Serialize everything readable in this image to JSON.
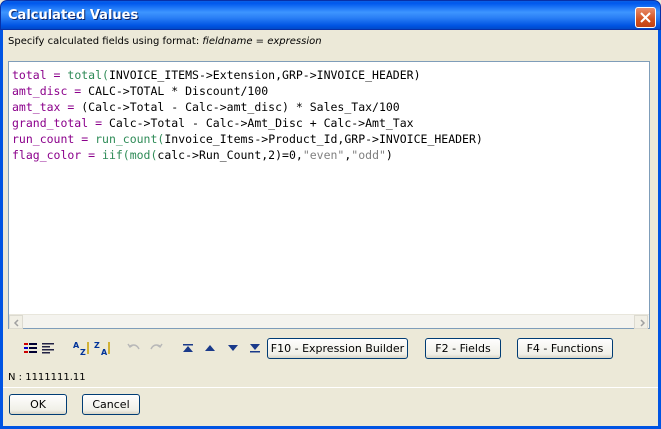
{
  "window": {
    "title": "Calculated Values"
  },
  "hint": {
    "prefix": "Specify calculated fields using format:",
    "format": "fieldname = expression"
  },
  "editor": {
    "lines": [
      [
        {
          "t": "total = ",
          "c": "field"
        },
        {
          "t": "total(",
          "c": "fn"
        },
        {
          "t": "INVOICE_ITEMS->Extension,GRP->INVOICE_HEADER)",
          "c": "txt"
        }
      ],
      [
        {
          "t": "amt_disc = ",
          "c": "field"
        },
        {
          "t": "CALC->TOTAL * Discount/100",
          "c": "txt"
        }
      ],
      [
        {
          "t": "amt_tax = ",
          "c": "field"
        },
        {
          "t": "(Calc->Total - Calc->amt_disc) * Sales_Tax/100",
          "c": "txt"
        }
      ],
      [
        {
          "t": "grand_total = ",
          "c": "field"
        },
        {
          "t": "Calc->Total - Calc->Amt_Disc + Calc->Amt_Tax",
          "c": "txt"
        }
      ],
      [
        {
          "t": "run_count = ",
          "c": "field"
        },
        {
          "t": "run_count(",
          "c": "fn"
        },
        {
          "t": "Invoice_Items->Product_Id,GRP->INVOICE_HEADER)",
          "c": "txt"
        }
      ],
      [
        {
          "t": "flag_color = ",
          "c": "field"
        },
        {
          "t": "iif(mod(",
          "c": "fn"
        },
        {
          "t": "calc->Run_Count,2)=0,",
          "c": "txt"
        },
        {
          "t": "\"even\"",
          "c": "str"
        },
        {
          "t": ",",
          "c": "txt"
        },
        {
          "t": "\"odd\"",
          "c": "str"
        },
        {
          "t": ")",
          "c": "txt"
        }
      ]
    ]
  },
  "toolbar": {
    "expression_builder": "F10 - Expression Builder",
    "fields": "F2 - Fields",
    "functions": "F4 - Functions"
  },
  "status": {
    "text": "N : 1111111.11"
  },
  "buttons": {
    "ok": "OK",
    "cancel": "Cancel"
  },
  "colors": {
    "field": "#8b008b",
    "fn": "#2e8b57",
    "str": "#808080",
    "titlebar": "#0054e3"
  }
}
